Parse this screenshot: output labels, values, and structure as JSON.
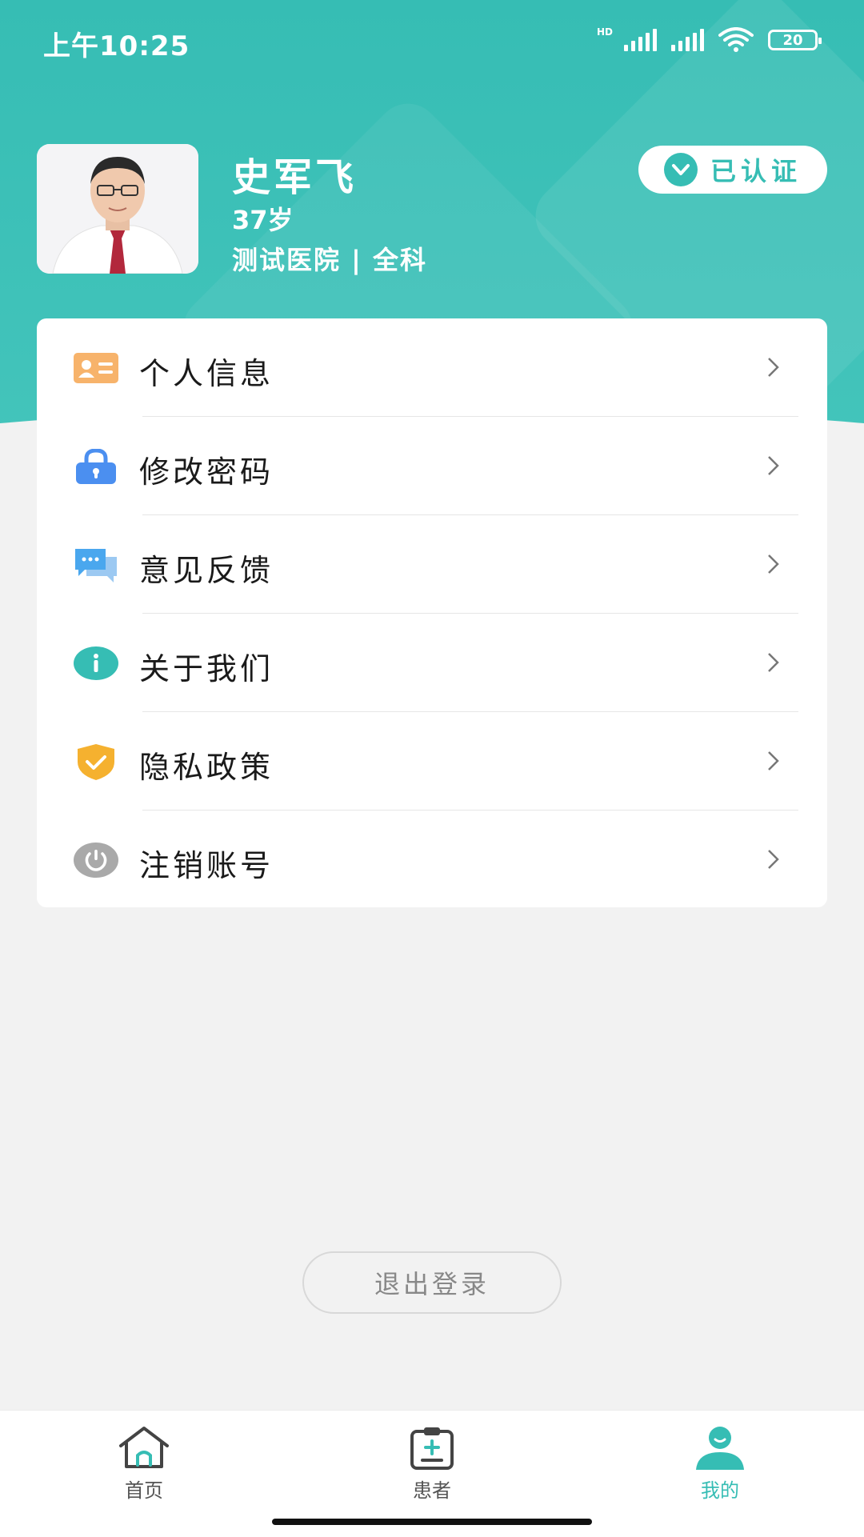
{
  "status_bar": {
    "time": "上午10:25",
    "hd": "HD",
    "battery": "20"
  },
  "profile": {
    "name": "史军飞",
    "age": "37岁",
    "org": "测试医院 | 全科",
    "verified_label": "已认证"
  },
  "menu": [
    {
      "label": "个人信息",
      "icon": "id-card-icon",
      "color": "#f7b36b"
    },
    {
      "label": "修改密码",
      "icon": "lock-icon",
      "color": "#4b8ff0"
    },
    {
      "label": "意见反馈",
      "icon": "chat-icon",
      "color": "#4aa7ee"
    },
    {
      "label": "关于我们",
      "icon": "info-icon",
      "color": "#36bdb4"
    },
    {
      "label": "隐私政策",
      "icon": "shield-check-icon",
      "color": "#f5b12f"
    },
    {
      "label": "注销账号",
      "icon": "power-icon",
      "color": "#a9a9a9"
    }
  ],
  "logout_label": "退出登录",
  "tabs": [
    {
      "label": "首页",
      "icon": "home-icon",
      "active": false
    },
    {
      "label": "患者",
      "icon": "clipboard-plus-icon",
      "active": false
    },
    {
      "label": "我的",
      "icon": "user-icon",
      "active": true
    }
  ],
  "colors": {
    "accent": "#36bdb4",
    "background": "#f2f2f2"
  }
}
